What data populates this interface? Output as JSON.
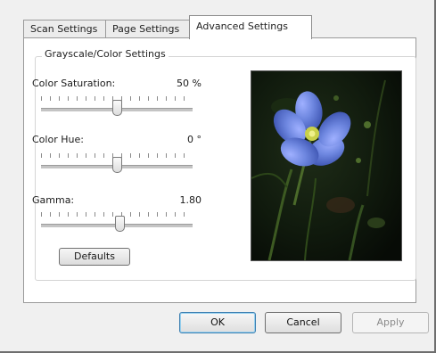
{
  "tabs": [
    {
      "label": "Scan Settings",
      "active": false
    },
    {
      "label": "Page Settings",
      "active": false
    },
    {
      "label": "Advanced Settings",
      "active": true
    }
  ],
  "group": {
    "title": "Grayscale/Color Settings",
    "sliders": [
      {
        "label": "Color Saturation:",
        "value_text": "50 %",
        "level": 0.5
      },
      {
        "label": "Color Hue:",
        "value_text": "0 °",
        "level": 0.5
      },
      {
        "label": "Gamma:",
        "value_text": "1.80",
        "level": 0.52
      }
    ],
    "defaults_label": "Defaults"
  },
  "preview": {
    "alt": "blue-flax-flower-photo"
  },
  "buttons": {
    "ok": "OK",
    "cancel": "Cancel",
    "apply": "Apply"
  },
  "colors": {
    "ok_border": "#3c7fb1",
    "flower": "#6d86df",
    "center": "#c8d04a"
  }
}
